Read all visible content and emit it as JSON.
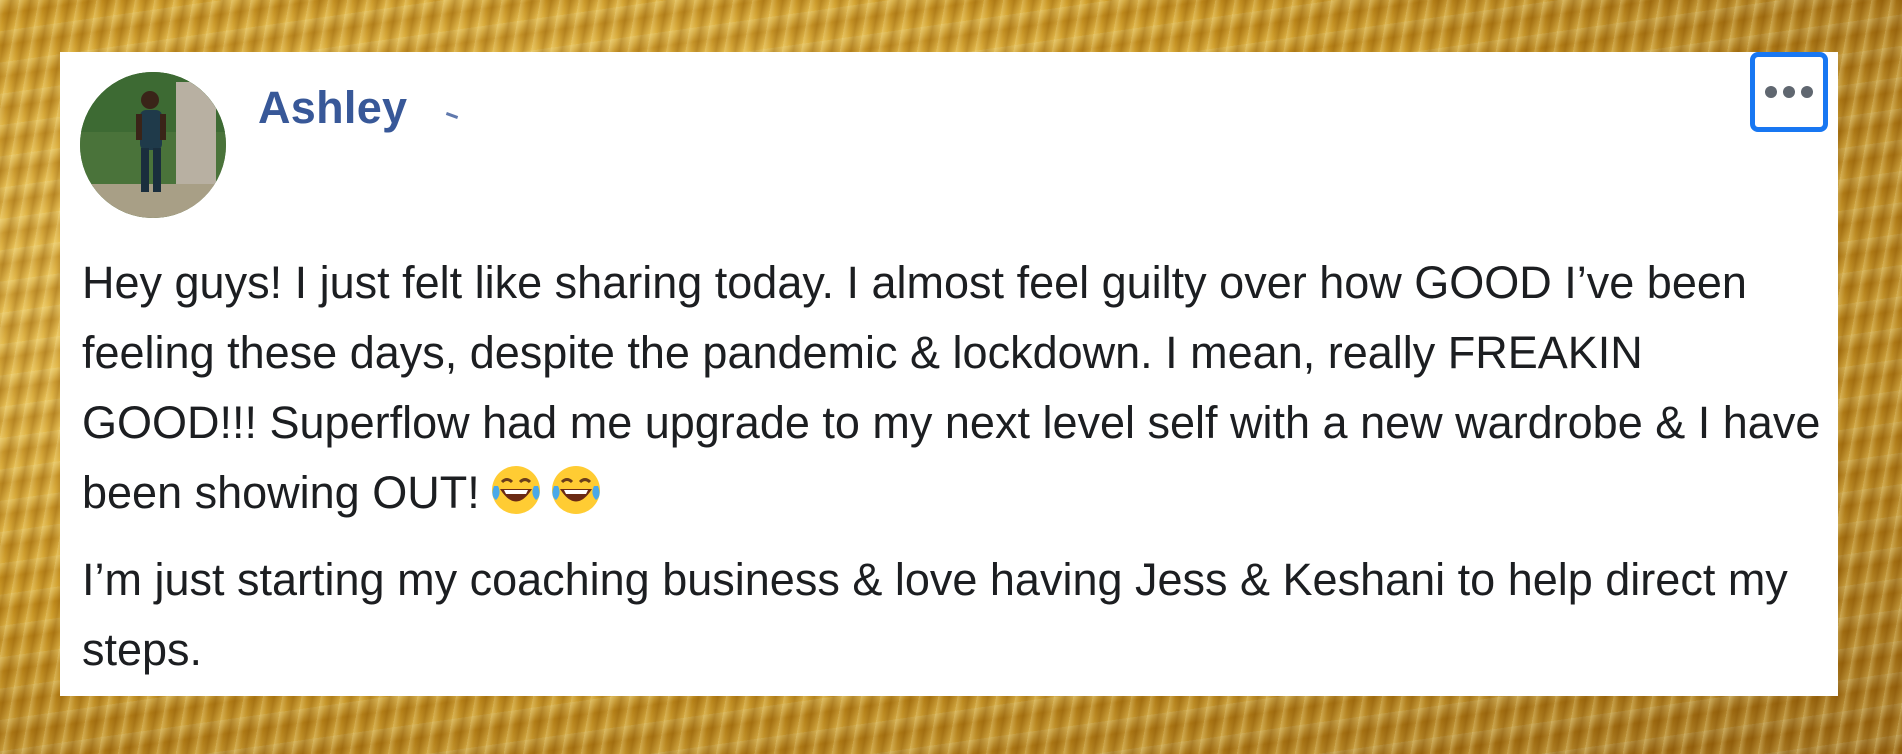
{
  "post": {
    "author": "Ashley",
    "paragraph_1": "Hey guys! I just felt like sharing today. I almost feel guilty over how GOOD I’ve been feeling these days, despite the pandemic & lockdown. I mean, really FREAKIN GOOD!!! Superflow had me upgrade to my next level self with a new wardrobe & I have been showing OUT!",
    "paragraph_1_emojis": [
      "laughing-tears-emoji",
      "laughing-tears-emoji"
    ],
    "paragraph_2": "I’m just starting my coaching business & love having Jess & Keshani to help direct my steps.",
    "more_icon": "more-options-icon"
  },
  "colors": {
    "author_link": "#385898",
    "focus_ring": "#1877f2",
    "text": "#1c1e21",
    "background": "gold-foil"
  }
}
